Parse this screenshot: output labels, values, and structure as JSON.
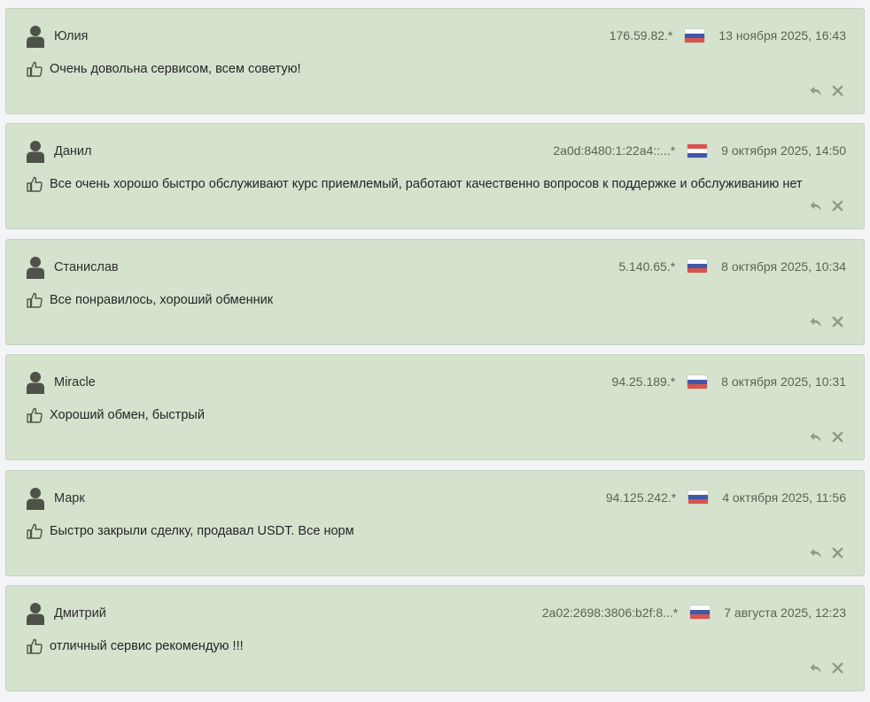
{
  "flags": {
    "ru": [
      "#ffffff",
      "#3f58a8",
      "#d9534f"
    ],
    "nl": [
      "#d9534f",
      "#ffffff",
      "#3f58a8"
    ]
  },
  "colors": {
    "card_bg": "#d5e2cd",
    "icon": "#4f5249",
    "action_icon": "#8f9889"
  },
  "reviews": [
    {
      "author": "Юлия",
      "ip": "176.59.82.*",
      "flag": "ru",
      "date": "13 ноября 2025, 16:43",
      "text": "Очень довольна сервисом, всем советую!"
    },
    {
      "author": "Данил",
      "ip": "2a0d:8480:1:22a4::...*",
      "flag": "nl",
      "date": "9 октября 2025, 14:50",
      "text": "Все очень хорошо быстро обслуживают курс приемлемый, работают качественно вопросов к поддержке и обслуживанию нет"
    },
    {
      "author": "Станислав",
      "ip": "5.140.65.*",
      "flag": "ru",
      "date": "8 октября 2025, 10:34",
      "text": "Все понравилось, хороший обменник"
    },
    {
      "author": "Miracle",
      "ip": "94.25.189.*",
      "flag": "ru",
      "date": "8 октября 2025, 10:31",
      "text": "Хороший обмен, быстрый"
    },
    {
      "author": "Марк",
      "ip": "94.125.242.*",
      "flag": "ru",
      "date": "4 октября 2025, 11:56",
      "text": "Быстро закрыли сделку, продавал USDT. Все норм"
    },
    {
      "author": "Дмитрий",
      "ip": "2a02:2698:3806:b2f:8...*",
      "flag": "ru",
      "date": "7 августа 2025, 12:23",
      "text": "отличный сервис рекомендую !!!"
    }
  ]
}
